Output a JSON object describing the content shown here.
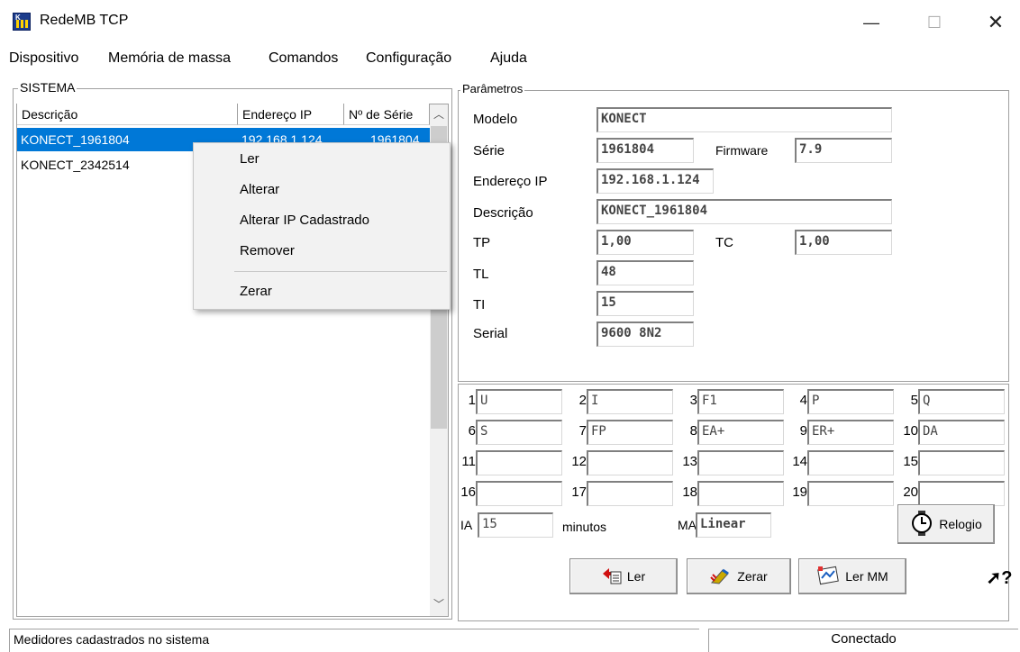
{
  "window": {
    "title": "RedeMB TCP",
    "minimize": "—",
    "maximize": "☐",
    "close": "✕"
  },
  "menu": [
    "Dispositivo",
    "Memória de massa",
    "Comandos",
    "Configuração",
    "Ajuda"
  ],
  "system": {
    "title": "SISTEMA",
    "columns": [
      "Descrição",
      "Endereço IP",
      "Nº de Série"
    ],
    "rows": [
      {
        "descricao": "KONECT_1961804",
        "ip": "192.168.1.124",
        "serie": "1961804",
        "selected": true
      },
      {
        "descricao": "KONECT_2342514",
        "ip": "",
        "serie": ""
      }
    ]
  },
  "context_menu": [
    "Ler",
    "Alterar",
    "Alterar IP Cadastrado",
    "Remover",
    "Zerar"
  ],
  "params": {
    "title": "Parâmetros",
    "modelo_label": "Modelo",
    "modelo": "KONECT",
    "serie_label": "Série",
    "serie": "1961804",
    "firmware_label": "Firmware",
    "firmware": "7.9",
    "ip_label": "Endereço IP",
    "ip": "192.168.1.124",
    "descricao_label": "Descrição",
    "descricao": "KONECT_1961804",
    "tp_label": "TP",
    "tp": "1,00",
    "tc_label": "TC",
    "tc": "1,00",
    "tl_label": "TL",
    "tl": "48",
    "ti_label": "TI",
    "ti": "15",
    "serial_label": "Serial",
    "serial": "9600 8N2"
  },
  "grid": {
    "cells": [
      {
        "n": "1",
        "v": "U"
      },
      {
        "n": "2",
        "v": "I"
      },
      {
        "n": "3",
        "v": "F1"
      },
      {
        "n": "4",
        "v": "P"
      },
      {
        "n": "5",
        "v": "Q"
      },
      {
        "n": "6",
        "v": "S"
      },
      {
        "n": "7",
        "v": "FP"
      },
      {
        "n": "8",
        "v": "EA+"
      },
      {
        "n": "9",
        "v": "ER+"
      },
      {
        "n": "10",
        "v": "DA"
      },
      {
        "n": "11",
        "v": ""
      },
      {
        "n": "12",
        "v": ""
      },
      {
        "n": "13",
        "v": ""
      },
      {
        "n": "14",
        "v": ""
      },
      {
        "n": "15",
        "v": ""
      },
      {
        "n": "16",
        "v": ""
      },
      {
        "n": "17",
        "v": ""
      },
      {
        "n": "18",
        "v": ""
      },
      {
        "n": "19",
        "v": ""
      },
      {
        "n": "20",
        "v": ""
      }
    ],
    "ia_label": "IA",
    "ia": "15",
    "minutos_label": "minutos",
    "ma_label": "MA",
    "ma": "Linear",
    "relogio": "Relogio"
  },
  "buttons": {
    "ler": "Ler",
    "zerar": "Zerar",
    "ler_mm": "Ler MM",
    "help": "?"
  },
  "status": {
    "left": "Medidores cadastrados no sistema",
    "right": "Conectado"
  }
}
